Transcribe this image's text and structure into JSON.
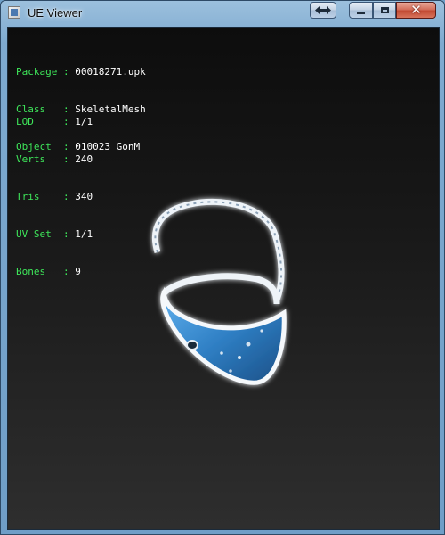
{
  "window": {
    "title": "UE Viewer",
    "icons": {
      "app": "app-icon",
      "resize": "resize-arrows-icon",
      "minimize": "minimize-icon",
      "maximize": "maximize-icon",
      "close": "close-icon"
    }
  },
  "info": {
    "rows1": [
      {
        "key": "Package",
        "sep": ":",
        "value": "00018271.upk"
      },
      {
        "key": "Class  ",
        "sep": ":",
        "value": "SkeletalMesh"
      },
      {
        "key": "Object ",
        "sep": ":",
        "value": "010023_GonM"
      }
    ],
    "rows2": [
      {
        "key": "LOD    ",
        "sep": ":",
        "value": "1/1"
      },
      {
        "key": "Verts  ",
        "sep": ":",
        "value": "240"
      },
      {
        "key": "Tris   ",
        "sep": ":",
        "value": "340"
      },
      {
        "key": "UV Set ",
        "sep": ":",
        "value": "1/1"
      },
      {
        "key": "Bones  ",
        "sep": ":",
        "value": "9"
      }
    ]
  },
  "colors": {
    "label": "#3ee65a",
    "value": "#ffffff",
    "viewport_top": "#0d0d0d",
    "viewport_bottom": "#2e2e2e",
    "mesh": "#2f7fc4"
  }
}
